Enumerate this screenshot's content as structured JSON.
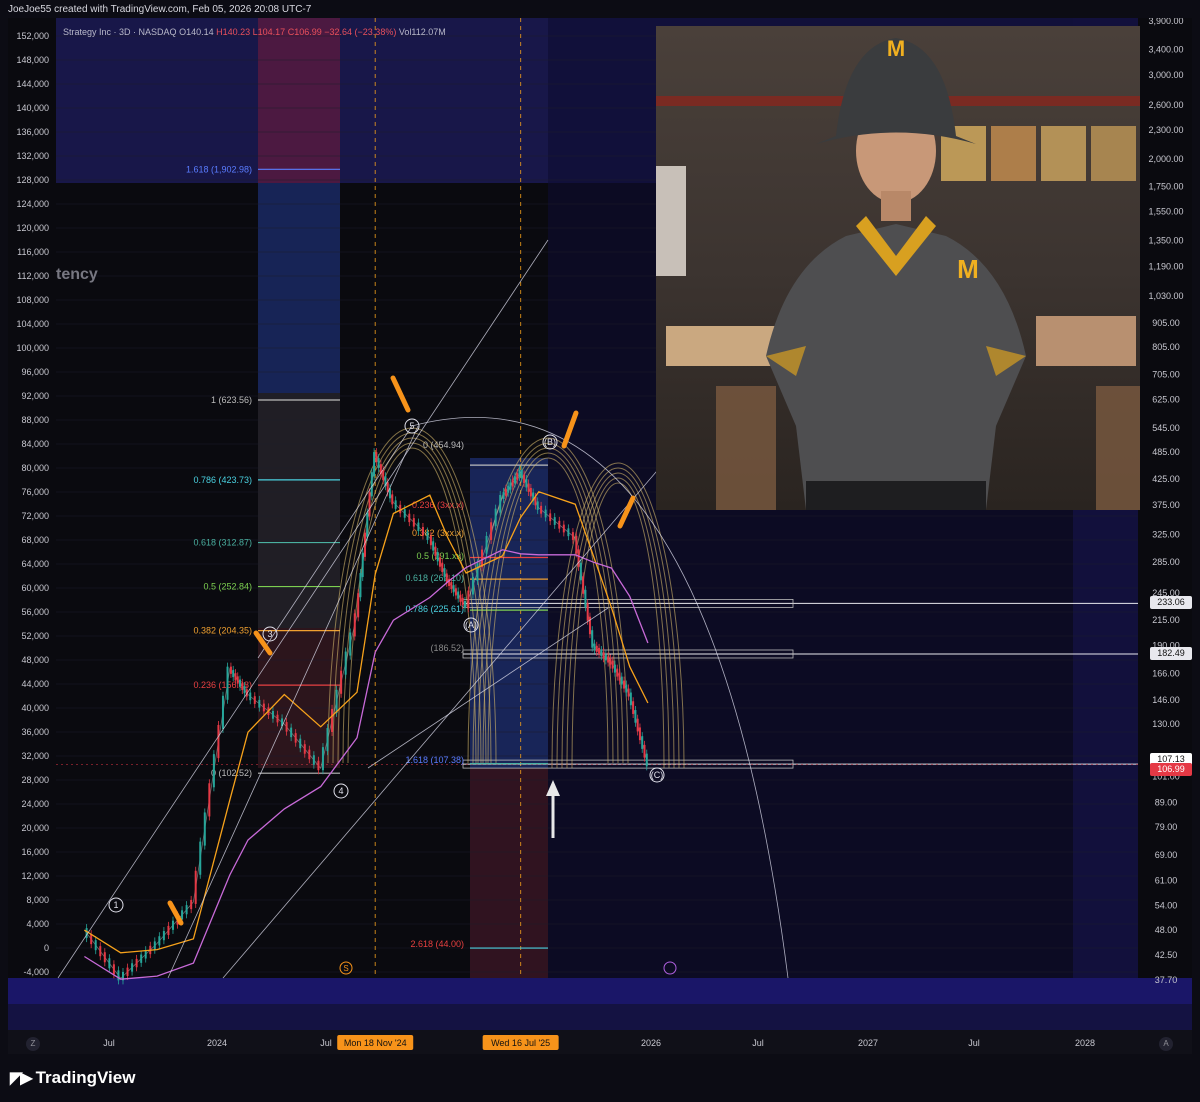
{
  "header": {
    "credit": "JoeJoe55 created with TradingView.com, Feb 05, 2026 20:08 UTC-7"
  },
  "legend": {
    "symbol": "Strategy Inc · 3D · NASDAQ",
    "open": "O140.14",
    "high": "H140.23",
    "low": "L104.17",
    "close": "C106.99",
    "change": "−32.64 (−23.38%)",
    "volume": "Vol112.07M"
  },
  "faded_text": "tency",
  "left_axis_labels": [
    "152,000",
    "148,000",
    "144,000",
    "140,000",
    "136,000",
    "132,000",
    "128,000",
    "124,000",
    "120,000",
    "116,000",
    "112,000",
    "108,000",
    "104,000",
    "100,000",
    "96,000",
    "92,000",
    "88,000",
    "84,000",
    "80,000",
    "76,000",
    "72,000",
    "68,000",
    "64,000",
    "60,000",
    "56,000",
    "52,000",
    "48,000",
    "44,000",
    "40,000",
    "36,000",
    "32,000",
    "28,000",
    "24,000",
    "20,000",
    "16,000",
    "12,000",
    "8,000",
    "4,000",
    "0",
    "-4,000"
  ],
  "right_axis_labels": [
    "3,900.00",
    "3,400.00",
    "3,000.00",
    "2,600.00",
    "2,300.00",
    "2,000.00",
    "1,750.00",
    "1,550.00",
    "1,350.00",
    "1,190.00",
    "1,030.00",
    "905.00",
    "805.00",
    "705.00",
    "625.00",
    "545.00",
    "485.00",
    "425.00",
    "375.00",
    "325.00",
    "285.00",
    "245.00",
    "215.00",
    "190.00",
    "166.00",
    "146.00",
    "130.00",
    "101.00",
    "89.00",
    "79.00",
    "69.00",
    "61.00",
    "54.00",
    "48.00",
    "42.50",
    "37.70"
  ],
  "price_tags": [
    {
      "text": "233.06",
      "bg": "#e8e8ee",
      "fg": "#111111"
    },
    {
      "text": "182.49",
      "bg": "#e8e8ee",
      "fg": "#111111"
    },
    {
      "text": "107.13",
      "bg": "#ffffff",
      "fg": "#111111"
    },
    {
      "text": "106.99",
      "bg": "#e53945",
      "fg": "#ffffff"
    }
  ],
  "time_axis": {
    "labels": [
      "Jul",
      "2024",
      "Jul",
      "2026",
      "Jul",
      "2027",
      "Jul",
      "2028"
    ],
    "highlighted": [
      "Mon 18 Nov '24",
      "Wed 16 Jul '25"
    ],
    "left_button": "Z",
    "right_button": "A"
  },
  "fib_left": [
    "1.618 (1,902.98)",
    "1 (623.56)",
    "0.786 (423.73)",
    "0.618 (312.87)",
    "0.5 (252.84)",
    "0.382 (204.35)",
    "0.236 (156.98)",
    "0 (102.52)"
  ],
  "fib_right": [
    "0 (454.94)",
    "0.236 (3xx.x)",
    "0.382 (3xx.x)",
    "0.5 (291.xx)",
    "0.618 (262.10)",
    "0.786 (225.61)",
    "1.618 (107.38)",
    "2.618 (44.00)",
    "(186.52)"
  ],
  "wave_labels": [
    "1",
    "3",
    "4",
    "5",
    "(A)",
    "(B)",
    "(C)"
  ],
  "event_icons": [
    "S"
  ],
  "brand": {
    "name": "TradingView"
  },
  "chart_data": {
    "type": "line",
    "title": "Strategy Inc · 3D · NASDAQ",
    "ohlc_last": {
      "open": 140.14,
      "high": 140.23,
      "low": 104.17,
      "close": 106.99
    },
    "change": -32.64,
    "change_pct": -23.38,
    "volume": "112.07M",
    "y_scale": "log",
    "ylim": [
      37.7,
      3900
    ],
    "xlim": [
      "2023-05",
      "2028-04"
    ],
    "x_ticks": [
      "Jul",
      "2024",
      "Jul",
      "Mon 18 Nov '24",
      "Wed 16 Jul '25",
      "2026",
      "Jul",
      "2027",
      "Jul",
      "2028"
    ],
    "horizontal_levels": [
      233.06,
      182.49,
      107.13
    ],
    "last_price": 106.99,
    "series": [
      {
        "name": "",
        "x": [
          "2023-07",
          "2023-09",
          "2023-11",
          "2024-01",
          "2024-03",
          "2024-04",
          "2024-06",
          "2024-08",
          "2024-10",
          "2024-11",
          "2024-12",
          "2025-02",
          "2025-03",
          "2025-04",
          "2025-06",
          "2025-07",
          "2025-08",
          "2025-10",
          "2025-11",
          "2025-12",
          "2026-01",
          "2026-02"
        ],
        "values": [
          48,
          38,
          45,
          55,
          170,
          150,
          130,
          105,
          220,
          480,
          380,
          320,
          260,
          230,
          390,
          440,
          370,
          320,
          190,
          175,
          150,
          107
        ]
      }
    ],
    "fibonacci_left": [
      {
        "level": 1.618,
        "price": 1902.98
      },
      {
        "level": 1,
        "price": 623.56
      },
      {
        "level": 0.786,
        "price": 423.73
      },
      {
        "level": 0.618,
        "price": 312.87
      },
      {
        "level": 0.5,
        "price": 252.84
      },
      {
        "level": 0.382,
        "price": 204.35
      },
      {
        "level": 0.236,
        "price": 156.98
      },
      {
        "level": 0,
        "price": 102.52
      }
    ],
    "fibonacci_right": [
      {
        "level": 0,
        "price": 454.94
      },
      {
        "level": 0.5,
        "price": 291.0
      },
      {
        "level": 0.618,
        "price": 262.1
      },
      {
        "level": 0.786,
        "price": 225.61
      },
      {
        "level": 1.618,
        "price": 107.38
      },
      {
        "level": 2.618,
        "price": 44.0
      }
    ],
    "grid": true,
    "colors": {
      "up": "#26a69a",
      "down": "#e53945",
      "ma_fast": "#f7a21b",
      "ma_slow": "#c86ad8",
      "fib_gold": "#d4b86a",
      "highlight_axis": "#f7931a"
    }
  }
}
